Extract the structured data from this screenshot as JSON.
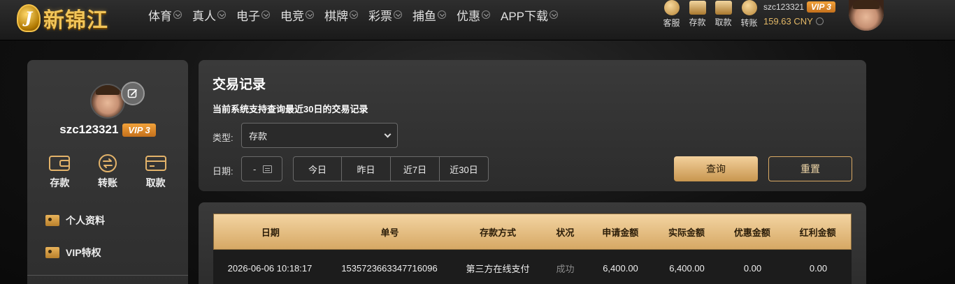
{
  "brand": {
    "logo_letter": "J",
    "name": "新锦江"
  },
  "nav": {
    "items": [
      "体育",
      "真人",
      "电子",
      "电竞",
      "棋牌",
      "彩票",
      "捕鱼",
      "优惠",
      "APP下载"
    ]
  },
  "quick_links": [
    {
      "label": "客服",
      "icon": "customer-service-icon"
    },
    {
      "label": "存款",
      "icon": "deposit-icon"
    },
    {
      "label": "取款",
      "icon": "withdraw-icon"
    },
    {
      "label": "转账",
      "icon": "transfer-icon"
    }
  ],
  "user": {
    "username": "szc123321",
    "vip": "VIP 3",
    "balance": "159.63 CNY"
  },
  "sidebar": {
    "actions": [
      {
        "label": "存款",
        "icon": "wallet-icon"
      },
      {
        "label": "转账",
        "icon": "transfer-icon"
      },
      {
        "label": "取款",
        "icon": "card-icon"
      }
    ],
    "menu": [
      {
        "label": "个人资料",
        "icon": "profile-icon"
      },
      {
        "label": "VIP特权",
        "icon": "vip-icon"
      }
    ]
  },
  "filter": {
    "title": "交易记录",
    "subtitle": "当前系统支持查询最近30日的交易记录",
    "type_label": "类型:",
    "type_value": "存款",
    "date_label": "日期:",
    "date_value": "-",
    "quick_dates": [
      "今日",
      "昨日",
      "近7日",
      "近30日"
    ],
    "query_label": "查询",
    "reset_label": "重置"
  },
  "table": {
    "headers": [
      "日期",
      "单号",
      "存款方式",
      "状况",
      "申请金额",
      "实际金额",
      "优惠金额",
      "红利金额"
    ],
    "rows": [
      [
        "2026-06-06 10:18:17",
        "1535723663347716096",
        "第三方在线支付",
        "成功",
        "6,400.00",
        "6,400.00",
        "0.00",
        "0.00"
      ]
    ]
  },
  "colors": {
    "accent_gold": "#d6a864",
    "vip_orange": "#e08a2a",
    "background": "#111111"
  }
}
